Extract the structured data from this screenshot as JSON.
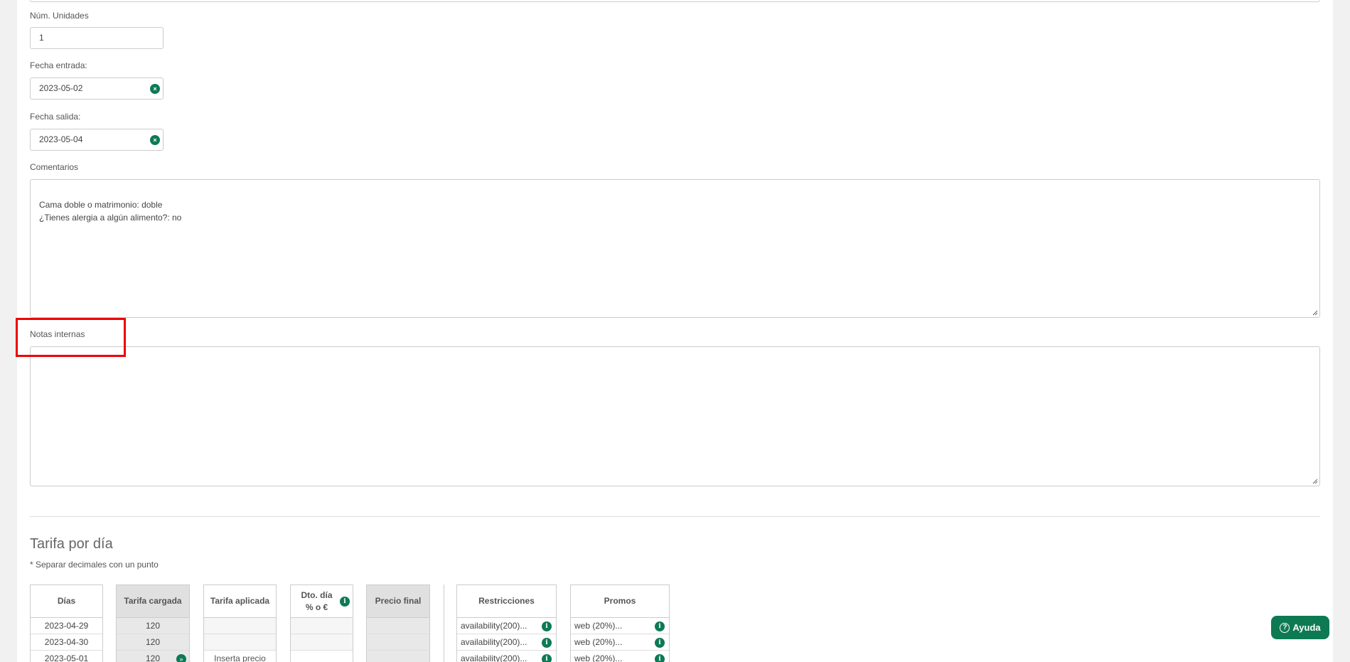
{
  "form": {
    "units_label": "Núm. Unidades",
    "units_value": "1",
    "checkin_label": "Fecha entrada:",
    "checkin_value": "2023-05-02",
    "checkout_label": "Fecha salida:",
    "checkout_value": "2023-05-04",
    "comments_label": "Comentarios",
    "comments_value": "Cama doble o matrimonio: doble\n¿Tienes alergia a algún alimento?: no",
    "notes_label": "Notas internas",
    "notes_value": ""
  },
  "rates": {
    "title": "Tarifa por día",
    "note": "* Separar decimales con un punto",
    "headers": {
      "days": "Días",
      "loaded": "Tarifa cargada",
      "applied": "Tarifa aplicada",
      "discount": "Dto. día\n% o €",
      "final": "Precio final",
      "restrictions": "Restricciones",
      "promos": "Promos"
    },
    "rows": [
      {
        "day": "2023-04-29",
        "loaded": "120",
        "applied": "",
        "restriction": "availability(200)...",
        "promo": "web (20%)..."
      },
      {
        "day": "2023-04-30",
        "loaded": "120",
        "applied": "",
        "restriction": "availability(200)...",
        "promo": "web (20%)..."
      },
      {
        "day": "2023-05-01",
        "loaded": "120",
        "applied": "Inserta precio",
        "restriction": "availability(200)...",
        "promo": "web (20%)..."
      }
    ]
  },
  "help": {
    "label": "Ayuda"
  },
  "colors": {
    "accent": "#0d7a54",
    "highlight": "#e00000"
  }
}
